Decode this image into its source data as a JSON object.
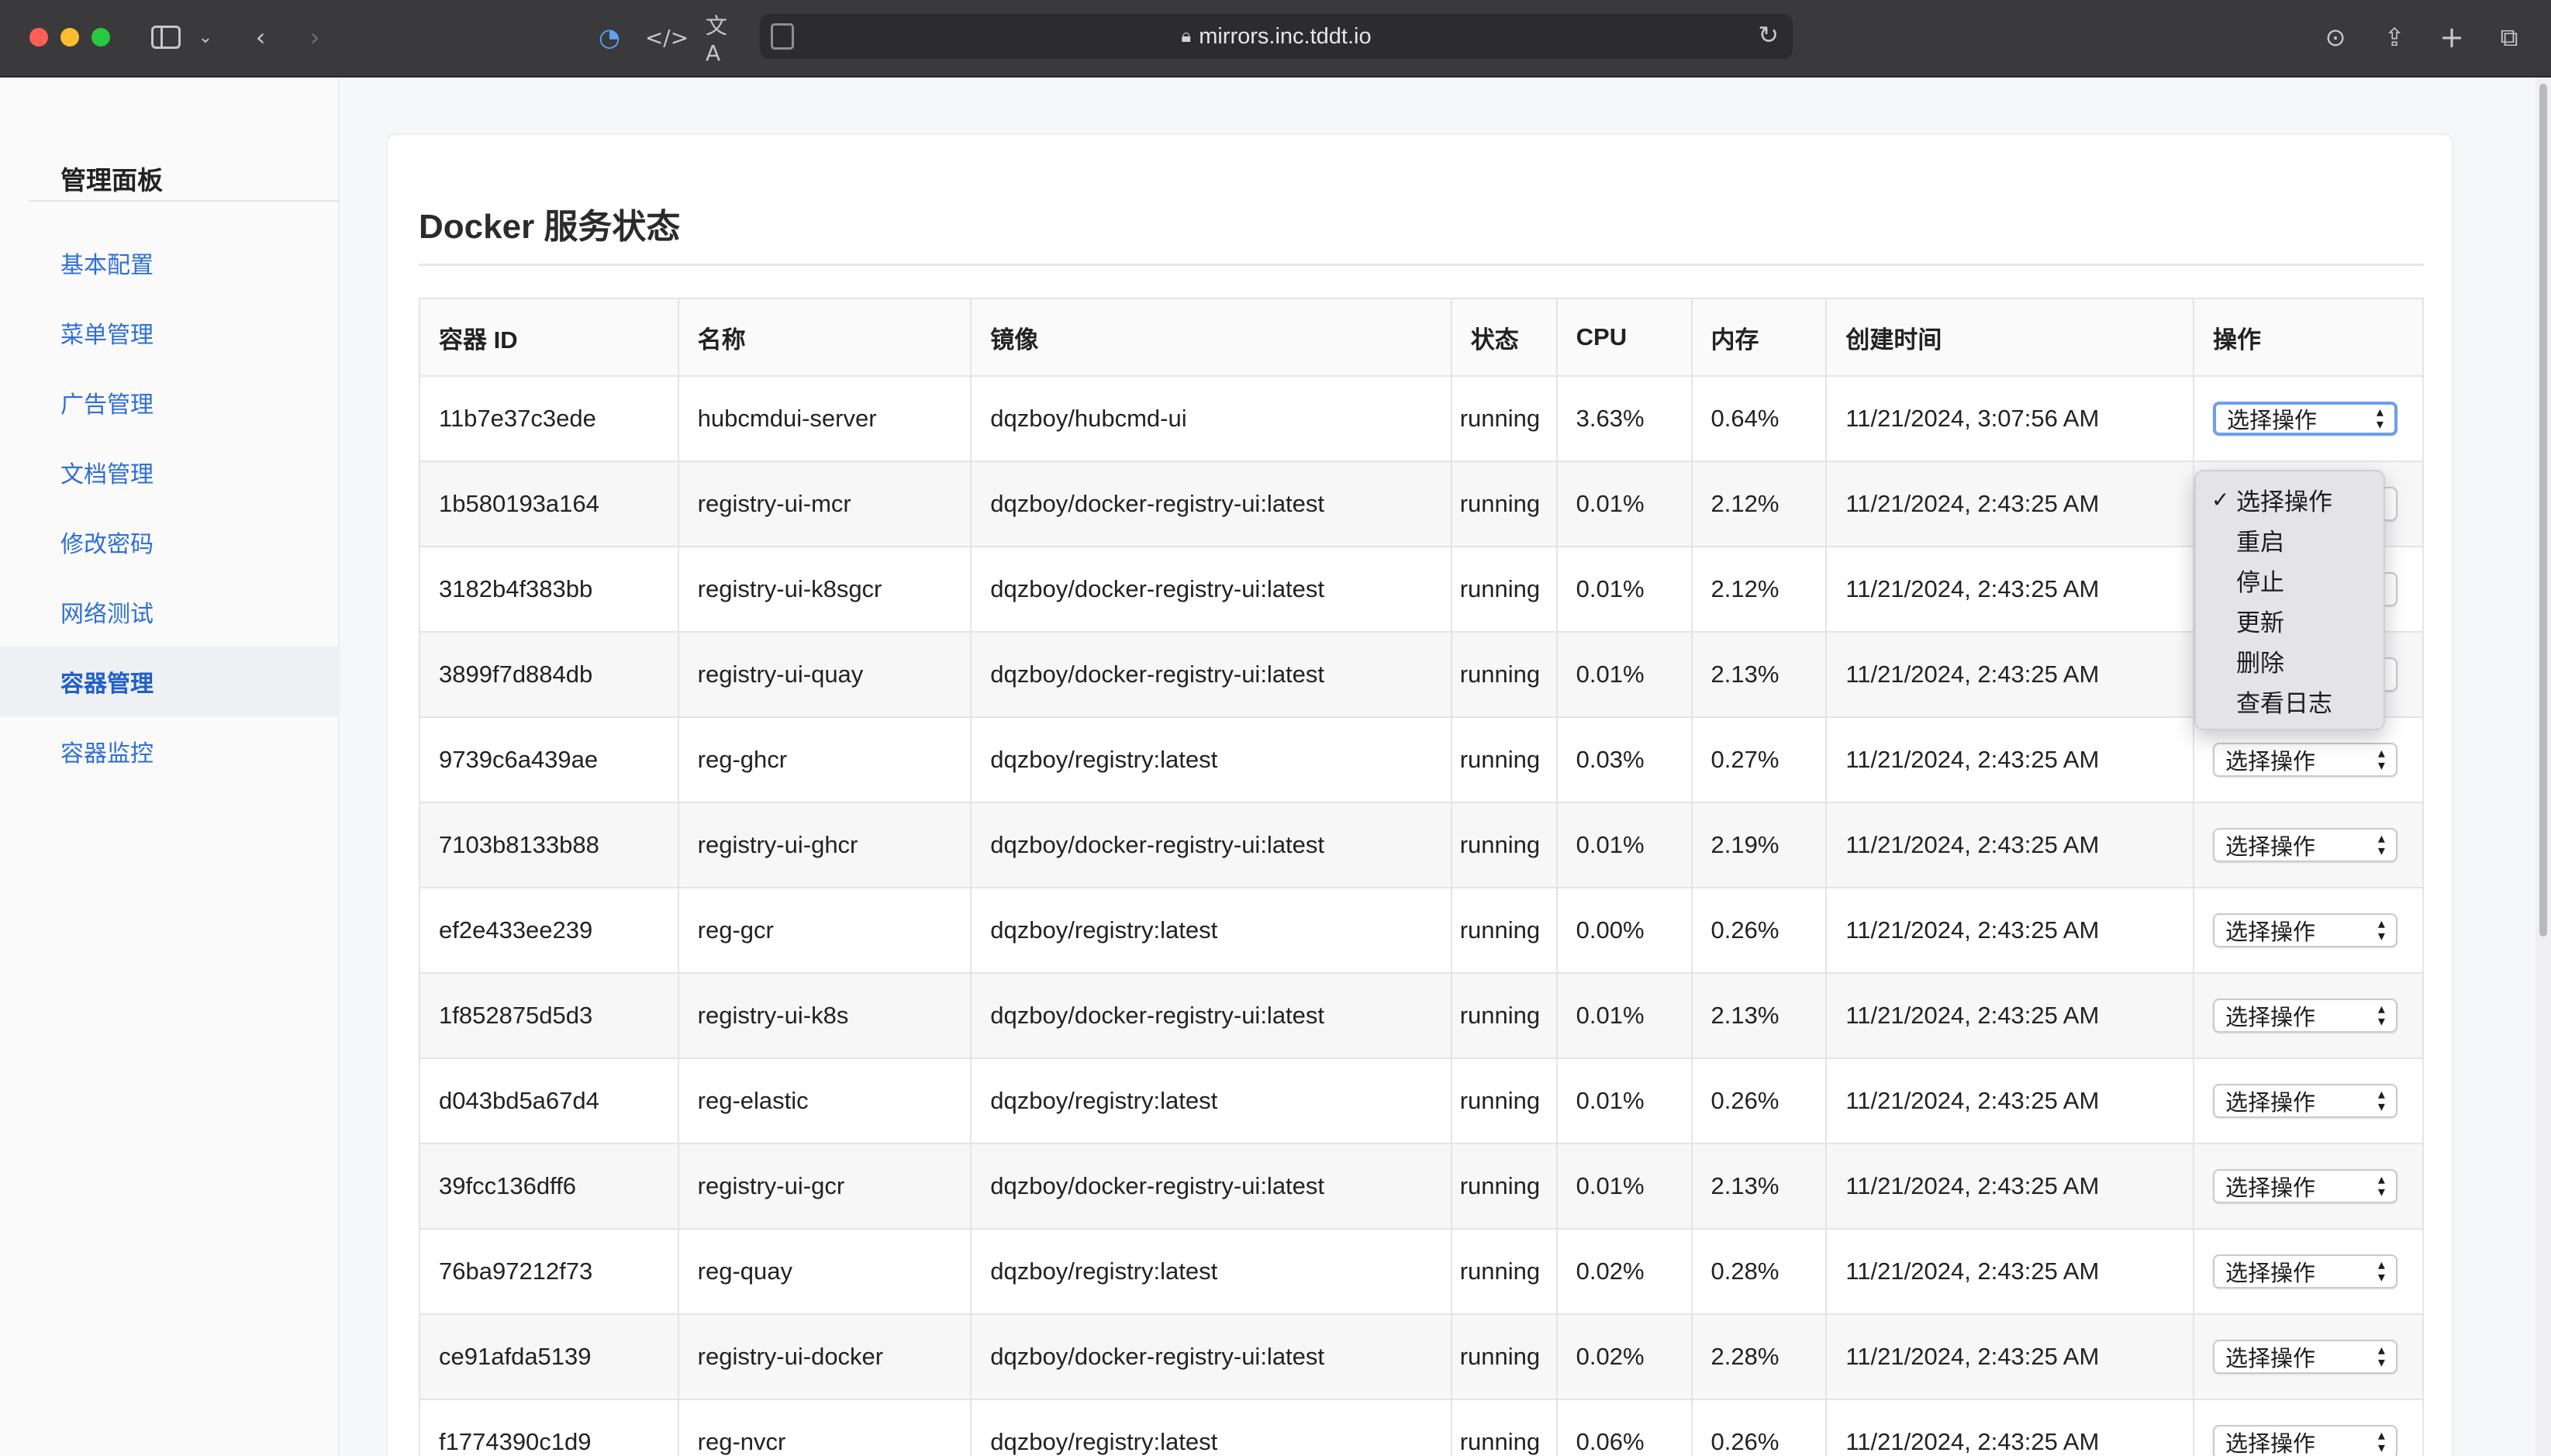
{
  "browser": {
    "url": "mirrors.inc.tddt.io",
    "icons": {
      "sidebar": "sidebar-icon",
      "back": "chevron-left-icon",
      "forward": "chevron-right-icon",
      "privacy": "shield-icon",
      "devtools": "code-icon",
      "translate": "translate-icon",
      "reader": "reader-icon",
      "reload": "reload-icon",
      "download": "download-icon",
      "share": "share-icon",
      "new_tab": "plus-icon",
      "tabs": "tabs-overview-icon"
    }
  },
  "sidebar": {
    "title": "管理面板",
    "items": [
      {
        "label": "基本配置",
        "active": false
      },
      {
        "label": "菜单管理",
        "active": false
      },
      {
        "label": "广告管理",
        "active": false
      },
      {
        "label": "文档管理",
        "active": false
      },
      {
        "label": "修改密码",
        "active": false
      },
      {
        "label": "网络测试",
        "active": false
      },
      {
        "label": "容器管理",
        "active": true
      },
      {
        "label": "容器监控",
        "active": false
      }
    ]
  },
  "main": {
    "title": "Docker 服务状态",
    "columns": [
      "容器 ID",
      "名称",
      "镜像",
      "状态",
      "CPU",
      "内存",
      "创建时间",
      "操作"
    ],
    "select_placeholder": "选择操作",
    "rows": [
      [
        "11b7e37c3ede",
        "hubcmdui-server",
        "dqzboy/hubcmd-ui",
        "running",
        "3.63%",
        "0.64%",
        "11/21/2024, 3:07:56 AM"
      ],
      [
        "1b580193a164",
        "registry-ui-mcr",
        "dqzboy/docker-registry-ui:latest",
        "running",
        "0.01%",
        "2.12%",
        "11/21/2024, 2:43:25 AM"
      ],
      [
        "3182b4f383bb",
        "registry-ui-k8sgcr",
        "dqzboy/docker-registry-ui:latest",
        "running",
        "0.01%",
        "2.12%",
        "11/21/2024, 2:43:25 AM"
      ],
      [
        "3899f7d884db",
        "registry-ui-quay",
        "dqzboy/docker-registry-ui:latest",
        "running",
        "0.01%",
        "2.13%",
        "11/21/2024, 2:43:25 AM"
      ],
      [
        "9739c6a439ae",
        "reg-ghcr",
        "dqzboy/registry:latest",
        "running",
        "0.03%",
        "0.27%",
        "11/21/2024, 2:43:25 AM"
      ],
      [
        "7103b8133b88",
        "registry-ui-ghcr",
        "dqzboy/docker-registry-ui:latest",
        "running",
        "0.01%",
        "2.19%",
        "11/21/2024, 2:43:25 AM"
      ],
      [
        "ef2e433ee239",
        "reg-gcr",
        "dqzboy/registry:latest",
        "running",
        "0.00%",
        "0.26%",
        "11/21/2024, 2:43:25 AM"
      ],
      [
        "1f852875d5d3",
        "registry-ui-k8s",
        "dqzboy/docker-registry-ui:latest",
        "running",
        "0.01%",
        "2.13%",
        "11/21/2024, 2:43:25 AM"
      ],
      [
        "d043bd5a67d4",
        "reg-elastic",
        "dqzboy/registry:latest",
        "running",
        "0.01%",
        "0.26%",
        "11/21/2024, 2:43:25 AM"
      ],
      [
        "39fcc136dff6",
        "registry-ui-gcr",
        "dqzboy/docker-registry-ui:latest",
        "running",
        "0.01%",
        "2.13%",
        "11/21/2024, 2:43:25 AM"
      ],
      [
        "76ba97212f73",
        "reg-quay",
        "dqzboy/registry:latest",
        "running",
        "0.02%",
        "0.28%",
        "11/21/2024, 2:43:25 AM"
      ],
      [
        "ce91afda5139",
        "registry-ui-docker",
        "dqzboy/docker-registry-ui:latest",
        "running",
        "0.02%",
        "2.28%",
        "11/21/2024, 2:43:25 AM"
      ],
      [
        "f1774390c1d9",
        "reg-nvcr",
        "dqzboy/registry:latest",
        "running",
        "0.06%",
        "0.26%",
        "11/21/2024, 2:43:25 AM"
      ]
    ]
  },
  "dropdown": {
    "options": [
      {
        "label": "选择操作",
        "checked": true
      },
      {
        "label": "重启",
        "checked": false
      },
      {
        "label": "停止",
        "checked": false
      },
      {
        "label": "更新",
        "checked": false
      },
      {
        "label": "删除",
        "checked": false
      },
      {
        "label": "查看日志",
        "checked": false
      }
    ]
  }
}
